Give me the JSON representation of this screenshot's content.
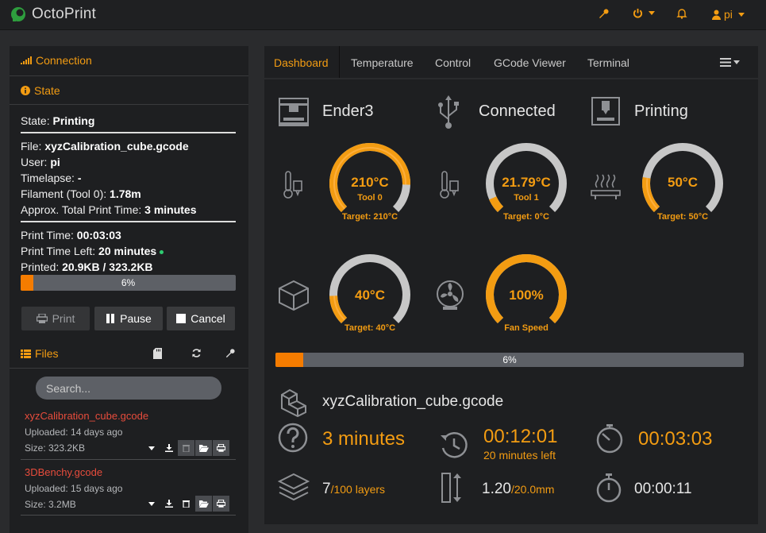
{
  "brand": {
    "name": "OctoPrint"
  },
  "navbar": {
    "user": "pi"
  },
  "sidebar": {
    "connection_title": "Connection",
    "state_title": "State",
    "state_lines": [
      {
        "label": "State:",
        "value": "Printing"
      },
      {
        "label": "File:",
        "value": "xyzCalibration_cube.gcode"
      },
      {
        "label": "User:",
        "value": "pi"
      },
      {
        "label": "Timelapse:",
        "value": "-"
      },
      {
        "label": "Filament (Tool 0):",
        "value": "1.78m"
      },
      {
        "label": "Approx. Total Print Time:",
        "value": "3 minutes"
      },
      {
        "label": "Print Time:",
        "value": "00:03:03"
      },
      {
        "label": "Print Time Left:",
        "value": "20 minutes"
      },
      {
        "label": "Printed:",
        "value": "20.9KB / 323.2KB"
      }
    ],
    "progress": {
      "percent": 6,
      "label": "6%"
    },
    "buttons": {
      "print": "Print",
      "pause": "Pause",
      "cancel": "Cancel"
    },
    "files_title": "Files",
    "search_placeholder": "Search...",
    "files": [
      {
        "name": "xyzCalibration_cube.gcode",
        "uploaded": "Uploaded: 14 days ago",
        "size": "Size: 323.2KB"
      },
      {
        "name": "3DBenchy.gcode",
        "uploaded": "Uploaded: 15 days ago",
        "size": "Size: 3.2MB"
      }
    ]
  },
  "tabs": [
    "Dashboard",
    "Temperature",
    "Control",
    "GCode Viewer",
    "Terminal"
  ],
  "dashboard": {
    "printer_name": "Ender3",
    "connection_status": "Connected",
    "print_status": "Printing",
    "gauges": [
      {
        "value": "210°C",
        "sub": "Tool 0",
        "target": "Target: 210°C",
        "fraction": 0.84
      },
      {
        "value": "21.79°C",
        "sub": "Tool 1",
        "target": "Target: 0°C",
        "fraction": 0.08
      },
      {
        "value": "50°C",
        "sub": "",
        "target": "Target: 50°C",
        "fraction": 0.2
      },
      {
        "value": "40°C",
        "sub": "",
        "target": "Target: 40°C",
        "fraction": 0.16
      },
      {
        "value": "100%",
        "sub": "",
        "target": "Fan Speed",
        "fraction": 1.0
      }
    ],
    "target_fractions": [
      0.84,
      0.0,
      0.2,
      0.16
    ],
    "progress": {
      "percent": 6,
      "label": "6%"
    },
    "file_name": "xyzCalibration_cube.gcode",
    "est_time": "3 minutes",
    "time_left": "00:12:01",
    "time_left_sub": "20 minutes left",
    "print_time": "00:03:03",
    "layers_current": "7",
    "layers_total": "/100 layers",
    "height_current": "1.20",
    "height_total": "/20.0mm",
    "layer_time": "00:00:11"
  },
  "colors": {
    "accent": "#f39c12",
    "progress": "#f57c00",
    "arc_bg": "#c7c7c7"
  }
}
